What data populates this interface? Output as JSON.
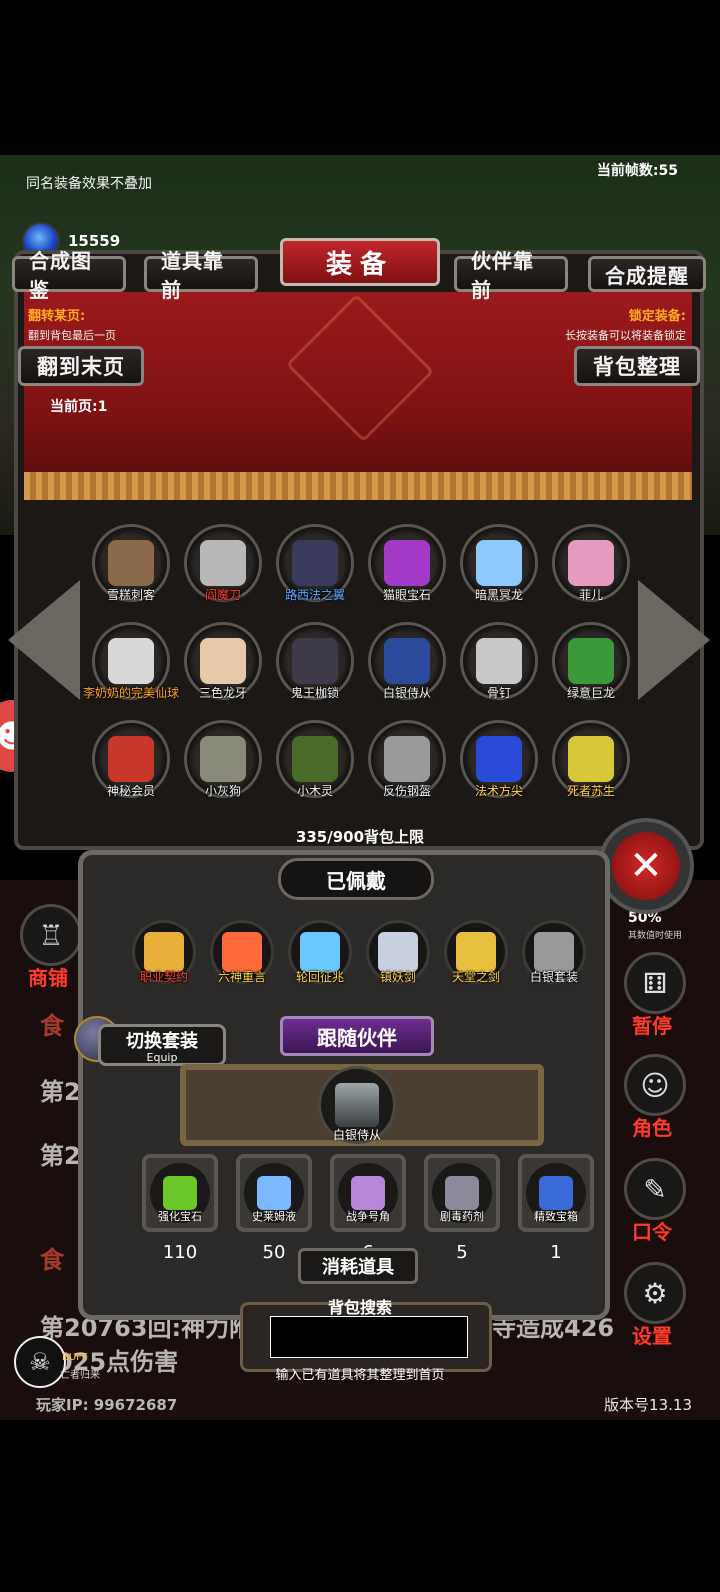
{
  "top": {
    "note": "同名装备效果不叠加",
    "fps": "当前帧数:55",
    "gem_count": "15559"
  },
  "header": {
    "title": "装备",
    "left_buttons": [
      "合成图鉴",
      "道具靠前"
    ],
    "right_buttons": [
      "伙伴靠前",
      "合成提醒"
    ],
    "flip_title": "翻转某页:",
    "flip_sub": "翻到背包最后一页",
    "lock_title": "锁定装备:",
    "lock_sub": "长按装备可以将装备锁定",
    "to_last_page": "翻到末页",
    "sort_bag": "背包整理",
    "current_page": "当前页:1"
  },
  "inventory": [
    {
      "name": "雪糕刺客",
      "color": "w",
      "icon_color": "#8a6a4a"
    },
    {
      "name": "阎魔刀",
      "color": "r",
      "icon_color": "#b8b8b8"
    },
    {
      "name": "路西法之翼",
      "color": "b",
      "icon_color": "#3a3a5c"
    },
    {
      "name": "猫眼宝石",
      "color": "w",
      "icon_color": "#a23ac8"
    },
    {
      "name": "暗黑冥龙",
      "color": "w",
      "icon_color": "#8fc8ff"
    },
    {
      "name": "菲儿",
      "color": "w",
      "icon_color": "#e59ac0"
    },
    {
      "name": "李奶奶的完美仙球",
      "color": "o",
      "icon_color": "#d8d8d8"
    },
    {
      "name": "三色龙牙",
      "color": "w",
      "icon_color": "#e7c8a8"
    },
    {
      "name": "鬼王枷锁",
      "color": "w",
      "icon_color": "#3e3a48"
    },
    {
      "name": "白银侍从",
      "color": "w",
      "icon_color": "#2c4a9c"
    },
    {
      "name": "骨钉",
      "color": "w",
      "icon_color": "#c8c8c8"
    },
    {
      "name": "绿意巨龙",
      "color": "w",
      "icon_color": "#3a9a3a"
    },
    {
      "name": "神秘会员",
      "color": "w",
      "icon_color": "#c8382a"
    },
    {
      "name": "小灰狗",
      "color": "w",
      "icon_color": "#8a8a7a"
    },
    {
      "name": "小木灵",
      "color": "w",
      "icon_color": "#4a6a2a"
    },
    {
      "name": "反伤钢盔",
      "color": "w",
      "icon_color": "#9a9a9a"
    },
    {
      "name": "法术方尖",
      "color": "y",
      "icon_color": "#2a4ad8"
    },
    {
      "name": "死者苏生",
      "color": "y",
      "icon_color": "#d8c838"
    }
  ],
  "bag_capacity": "335/900背包上限",
  "equipped": {
    "title": "已佩戴",
    "items": [
      {
        "name": "职业契约",
        "color": "r",
        "icon_color": "#e8b03a"
      },
      {
        "name": "六神重言",
        "color": "y",
        "icon_color": "#ff6a3a"
      },
      {
        "name": "轮回征兆",
        "color": "y",
        "icon_color": "#6ac8ff"
      },
      {
        "name": "镇妖剑",
        "color": "y",
        "icon_color": "#c8d0e0"
      },
      {
        "name": "天堂之剑",
        "color": "y",
        "icon_color": "#e8c040"
      },
      {
        "name": "白银套装",
        "color": "w",
        "icon_color": "#9a9a9a"
      }
    ]
  },
  "switch_set": {
    "label": "切换套装",
    "sub": "Equip"
  },
  "companion": {
    "title": "跟随伙伴",
    "name": "白银侍从"
  },
  "consumables": {
    "title": "消耗道具",
    "items": [
      {
        "name": "强化宝石",
        "count": "110",
        "icon_color": "#6ac82a"
      },
      {
        "name": "史莱姆液",
        "count": "50",
        "icon_color": "#7ab8ff"
      },
      {
        "name": "战争号角",
        "count": "6",
        "icon_color": "#b888d8"
      },
      {
        "name": "剧毒药剂",
        "count": "5",
        "icon_color": "#8a8a9a"
      },
      {
        "name": "精致宝箱",
        "count": "1",
        "icon_color": "#3a6ad8"
      }
    ]
  },
  "search": {
    "title": "背包搜索",
    "hint": "输入已有道具将其整理到首页",
    "value": ""
  },
  "side": {
    "shop": "商铺",
    "pause": "暂停",
    "role": "角色",
    "code": "口令",
    "settings": "设置",
    "pct": "50%",
    "pct_sub": "其数值时使用"
  },
  "log": {
    "rows": [
      "第20763回:神力附",
      "寺造成426",
      "025点伤害"
    ],
    "frag": [
      "食",
      "第20",
      "第20",
      "食"
    ]
  },
  "buff": {
    "title": "BUFF",
    "sub": "亡者归来"
  },
  "footer": {
    "player_ip": "玩家IP: 99672687",
    "version": "版本号13.13"
  }
}
